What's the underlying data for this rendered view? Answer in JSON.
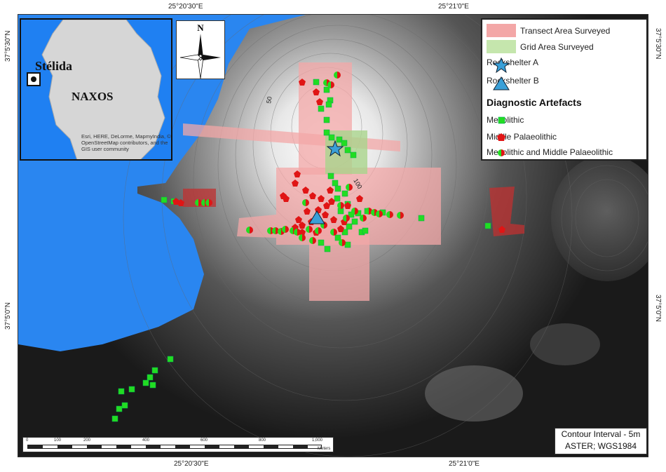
{
  "coordinates": {
    "top_left": "25°20'30\"E",
    "top_right": "25°21'0\"E",
    "bottom_left": "25°20'30\"E",
    "bottom_right": "25°21'0\"E",
    "left_top": "37°5'30\"N",
    "left_bottom": "37°5'0\"N",
    "right_top": "37°5'30\"N",
    "right_bottom": "37°5'0\"N"
  },
  "inset": {
    "place_label": "Stélida",
    "island_label": "NAXOS",
    "credits": "Esri, HERE, DeLorme, MapmyIndia, © OpenStreetMap contributors, and the GIS user community"
  },
  "north_arrow": {
    "label": "N"
  },
  "legend": {
    "transect": "Transect Area Surveyed",
    "grid": "Grid Area Surveyed",
    "rockshelter_a": "Rockshelter A",
    "rockshelter_b": "Rockshelter B",
    "diagnostic_title": "Diagnostic Artefacts",
    "mesolithic": "Mesolithic",
    "middle_palaeolithic": "Middle Palaeolithic",
    "both": "Mesolithic and Middle Palaeolithic"
  },
  "contour_labels": [
    "50",
    "100"
  ],
  "info_box": {
    "line1": "Contour Interval - 5m",
    "line2": "ASTER; WGS1984"
  },
  "scale": {
    "ticks": [
      "0",
      "100",
      "200",
      "400",
      "600",
      "800",
      "1,000"
    ],
    "unit": "Meters"
  },
  "colors": {
    "sea": "#2a86f0",
    "transect": "#f3a7a7",
    "grid": "#b6dc9c",
    "mesolithic": "#22dd22",
    "middle_palaeolithic": "#e01515",
    "rockshelter": "#3aa0d8"
  }
}
